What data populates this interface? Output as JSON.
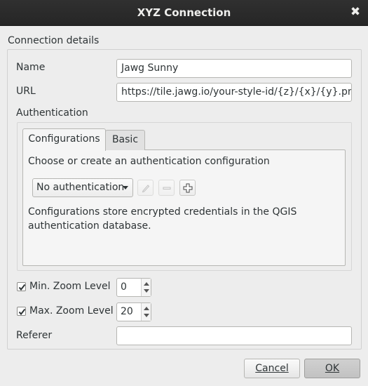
{
  "window": {
    "title": "XYZ Connection",
    "close_glyph": "✖"
  },
  "connection_details": {
    "group_title": "Connection details",
    "name_label": "Name",
    "name_value": "Jawg Sunny",
    "url_label": "URL",
    "url_value": "https://tile.jawg.io/your-style-id/{z}/{x}/{y}.png?acc"
  },
  "authentication": {
    "section_label": "Authentication",
    "tabs": [
      {
        "label": "Configurations",
        "active": true
      },
      {
        "label": "Basic",
        "active": false
      }
    ],
    "prompt": "Choose or create an authentication configuration",
    "combo_value": "No authentication",
    "edit_icon": "pencil-icon",
    "remove_icon": "minus-icon",
    "add_icon": "plus-icon",
    "info_line1": "Configurations store encrypted credentials in the QGIS",
    "info_line2": "authentication database."
  },
  "zoom": {
    "min_label": "Min. Zoom Level",
    "min_checked": true,
    "min_value": "0",
    "max_label": "Max. Zoom Level",
    "max_checked": true,
    "max_value": "20"
  },
  "referer": {
    "label": "Referer",
    "value": ""
  },
  "buttons": {
    "cancel_label": "Cancel",
    "ok_label": "OK"
  },
  "colors": {
    "titlebar": "#2b2b2b",
    "dialog_bg": "#ededed",
    "text": "#2e3436"
  }
}
